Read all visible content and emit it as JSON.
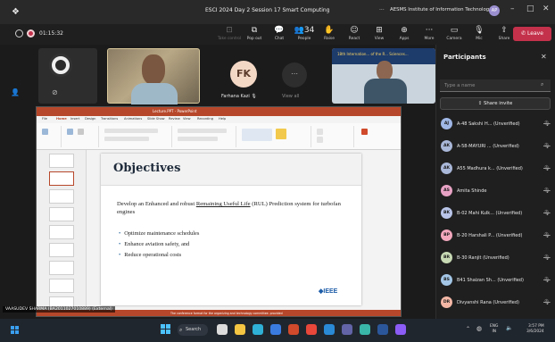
{
  "window": {
    "title": "ESCI 2024 Day 2 Session 17 Smart Computing",
    "org_name": "AESMS Institute of Information Technology",
    "org_initials": "AP",
    "dots": "···",
    "controls": {
      "minimize": "–",
      "maximize": "□",
      "close": "✕"
    }
  },
  "meeting": {
    "timer": "01:15:32",
    "toolbar": [
      {
        "label": "Take control",
        "icon": "⊡",
        "dim": true
      },
      {
        "label": "Pop out",
        "icon": "⧉",
        "dim": false
      },
      {
        "label": "Chat",
        "icon": "💬",
        "dim": false
      },
      {
        "label": "People",
        "icon": "👥34",
        "dim": false
      },
      {
        "label": "Raise",
        "icon": "✋",
        "dim": false
      },
      {
        "label": "React",
        "icon": "☺",
        "dim": false
      },
      {
        "label": "View",
        "icon": "⊞",
        "dim": false
      },
      {
        "label": "Apps",
        "icon": "⊕",
        "dim": false
      },
      {
        "label": "More",
        "icon": "···",
        "dim": false
      },
      {
        "label": "Camera",
        "icon": "▭",
        "dim": false
      },
      {
        "label": "Mic",
        "icon": "🎙",
        "dim": false
      },
      {
        "label": "Share",
        "icon": "⇪",
        "dim": false
      }
    ],
    "leave_label": "Leave"
  },
  "stage": {
    "fk_initials": "FK",
    "fk_name": "Farhana Kazi",
    "view_all_label": "View all",
    "view_all_icon": "⋯",
    "presenter_banner": "18th Internation... of the R... Sciences..."
  },
  "presentation": {
    "app_title": "Lecture.PPT - PowerPoint",
    "tabs": [
      "File",
      "Home",
      "Insert",
      "Design",
      "Transitions",
      "Animations",
      "Slide Show",
      "Review",
      "View",
      "Recording",
      "Help"
    ],
    "slide_title": "Objectives",
    "objective_pre": "Develop an Enhanced and robust ",
    "objective_link": "Remaining Useful Life",
    "objective_post": " (RUL) Prediction system for turbofan engines",
    "bullets": [
      "Optimize maintenance schedules",
      "Enhance aviation safety, and",
      "Reduce operational costs"
    ],
    "logo_text": "◆IEEE",
    "status_text": "The conference format for the organizing and technology committee. provided",
    "sharer": "VAASUDEV SHARMA (BA2011027010889) (External)"
  },
  "participants": {
    "title": "Participants",
    "search_placeholder": "Type a name",
    "share_invite_label": "Share invite",
    "list": [
      {
        "initials": "AJ",
        "name": "A-48 Sakshi H... (Unverified)",
        "color": "#9fb7e6"
      },
      {
        "initials": "AK",
        "name": "A-58-MAYURI ... (Unverified)",
        "color": "#a9b7d8"
      },
      {
        "initials": "AK",
        "name": "A55 Madhura k... (Unverified)",
        "color": "#a9b7d8"
      },
      {
        "initials": "AS",
        "name": "Amita Shinde",
        "color": "#e8a3c4"
      },
      {
        "initials": "BK",
        "name": "B-02 Mahi Kulk... (Unverified)",
        "color": "#b9c4e8"
      },
      {
        "initials": "BP",
        "name": "B-20 Harshali P... (Unverified)",
        "color": "#f2a7bd"
      },
      {
        "initials": "BR",
        "name": "B-30 Ranjit (Unverified)",
        "color": "#c7d9b3"
      },
      {
        "initials": "BS",
        "name": "B41 Shaizan Sh... (Unverified)",
        "color": "#a3c6e6"
      },
      {
        "initials": "DR",
        "name": "Divyanshi Rana (Unverified)",
        "color": "#f4b7a6"
      }
    ],
    "mic_icon": "🎙"
  },
  "taskbar": {
    "search_label": "Search",
    "apps": [
      {
        "name": "task-view-icon",
        "color": "#dcdcdc"
      },
      {
        "name": "file-explorer-icon",
        "color": "#f4c542"
      },
      {
        "name": "edge-icon",
        "color": "#2fb0d6"
      },
      {
        "name": "store-icon",
        "color": "#3a7be0"
      },
      {
        "name": "powerpoint-icon",
        "color": "#d04a2b"
      },
      {
        "name": "chrome-icon",
        "color": "#e8473a"
      },
      {
        "name": "vscode-icon",
        "color": "#2a8ad6"
      },
      {
        "name": "teams-icon",
        "color": "#6264a7"
      },
      {
        "name": "copilot-icon",
        "color": "#39b6a8"
      },
      {
        "name": "word-icon",
        "color": "#2b579a"
      },
      {
        "name": "photos-icon",
        "color": "#8b5cf6"
      }
    ],
    "lang_top": "ENG",
    "lang_bottom": "IN",
    "time": "3:57 PM",
    "date": "3/6/2024"
  }
}
